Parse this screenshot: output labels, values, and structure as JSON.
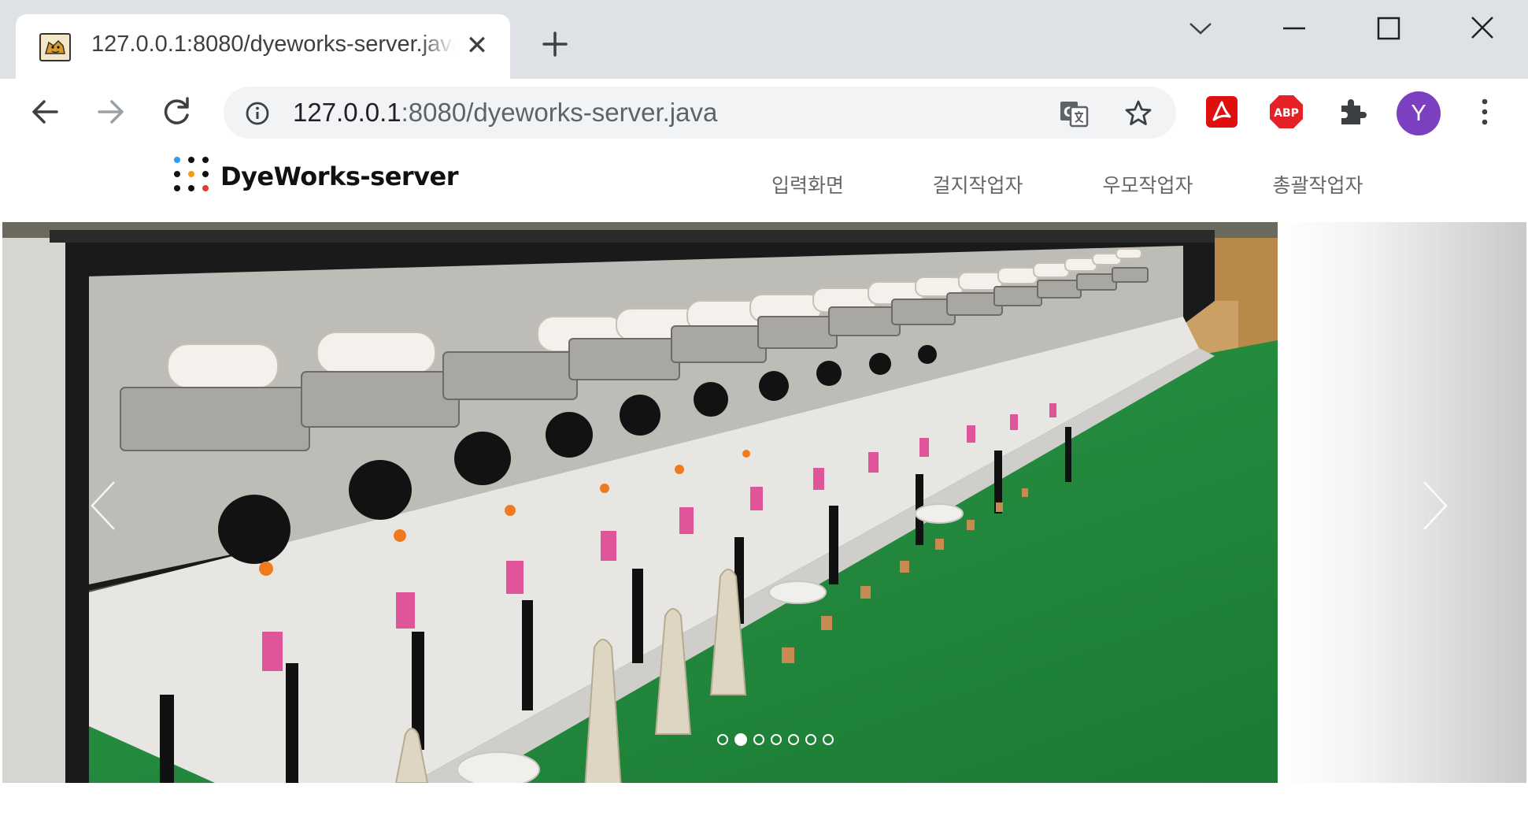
{
  "browser": {
    "tab": {
      "title": "127.0.0.1:8080/dyeworks-server.java",
      "favicon": "tomcat-favicon"
    },
    "address": {
      "host": "127.0.0.1",
      "rest": ":8080/dyeworks-server.java"
    },
    "profile_initial": "Y",
    "extensions": [
      "acrobat-pdf-icon",
      "adblock-plus-icon",
      "extensions-puzzle-icon"
    ],
    "colors": {
      "tabstrip": "#dee1e6",
      "omnibox": "#f1f3f4",
      "avatar": "#7b3fc0",
      "pdf": "#e00f0f",
      "abp": "#e32127"
    }
  },
  "site": {
    "logo_text": "DyeWorks-server",
    "nav": [
      "입력화면",
      "걸지작업자",
      "우모작업자",
      "총괄작업자"
    ]
  },
  "carousel": {
    "slide_count": 7,
    "active_index": 1,
    "prev_icon": "chevron-left-icon",
    "next_icon": "chevron-right-icon",
    "colors": {
      "floor": "#1f8a3c",
      "machine_frame": "#1a1a1a",
      "machine_panel": "#c9c9c6"
    }
  }
}
